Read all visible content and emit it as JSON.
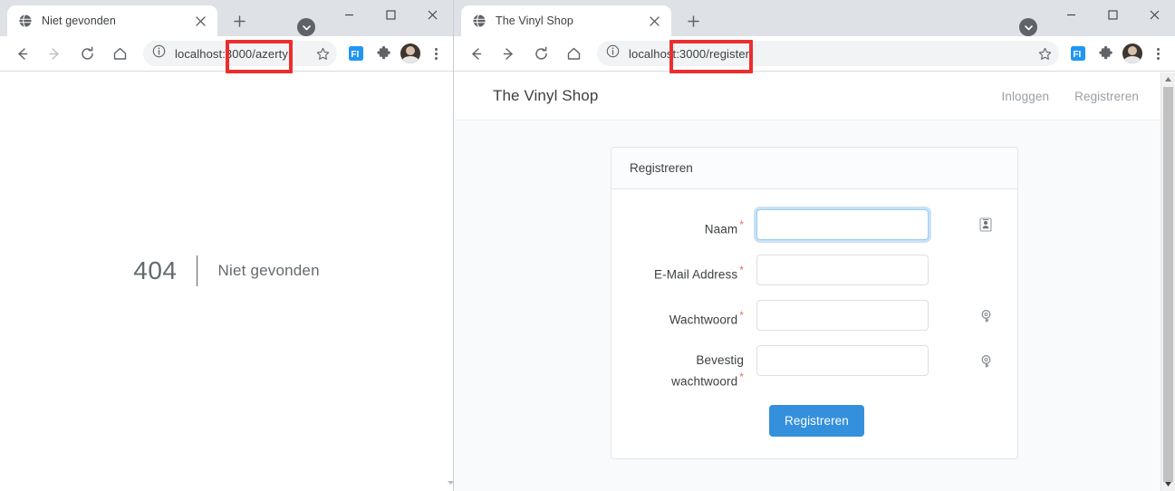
{
  "left_browser": {
    "tab": {
      "title": "Niet gevonden",
      "favicon": "globe-icon",
      "close": "×"
    },
    "new_tab_label": "+",
    "toolbar": {
      "back": "back-arrow",
      "forward": "forward-arrow",
      "reload": "reload-icon",
      "home": "home-icon",
      "url": "localhost:3000/azerty",
      "url_visible_prefix": "localhost:3",
      "url_highlighted": "000/azerty",
      "star": "bookmark-star-icon",
      "kebab": "more-menu-icon"
    },
    "window_controls": {
      "minimize": "—",
      "maximize": "▢",
      "close": "✕"
    },
    "page": {
      "error_code": "404",
      "error_message": "Niet gevonden"
    }
  },
  "right_browser": {
    "tab": {
      "title": "The Vinyl Shop",
      "favicon": "globe-icon",
      "close": "×"
    },
    "new_tab_label": "+",
    "toolbar": {
      "back": "back-arrow",
      "forward": "forward-arrow",
      "reload": "reload-icon",
      "home": "home-icon",
      "url": "localhost:3000/register",
      "star": "bookmark-star-icon",
      "kebab": "more-menu-icon"
    },
    "window_controls": {
      "minimize": "—",
      "maximize": "▢",
      "close": "✕"
    },
    "page": {
      "brand": "The Vinyl Shop",
      "nav_links": [
        {
          "label": "Inloggen"
        },
        {
          "label": "Registreren"
        }
      ],
      "card": {
        "title": "Registreren",
        "required_marker": "*",
        "fields": [
          {
            "label": "Naam",
            "value": "",
            "placeholder": "",
            "required": true,
            "focused": true,
            "icon": "contact-card-icon",
            "type": "text"
          },
          {
            "label": "E-Mail Address",
            "value": "",
            "placeholder": "",
            "required": true,
            "focused": false,
            "icon": "none",
            "type": "email"
          },
          {
            "label": "Wachtwoord",
            "value": "",
            "placeholder": "",
            "required": true,
            "focused": false,
            "icon": "key-icon",
            "type": "password"
          },
          {
            "label": "Bevestig wachtwoord",
            "value": "",
            "placeholder": "",
            "required": true,
            "focused": false,
            "icon": "key-icon",
            "type": "password"
          }
        ],
        "submit_label": "Registreren"
      }
    }
  },
  "annotations": {
    "highlight_color": "#ec2d2d",
    "boxes": [
      {
        "target": "left-url-segment",
        "text": "000/azerty"
      },
      {
        "target": "right-url-segment",
        "text": "000/register"
      }
    ]
  },
  "colors": {
    "tabstrip_bg": "#dee1e6",
    "toolbar_bg": "#ffffff",
    "omnibox_bg": "#f1f3f4",
    "page_bg": "#f8fafc",
    "primary_button": "#3490dc",
    "focus_ring": "#9ecbf0",
    "required_star": "#e8705a",
    "error_text": "#636b6f",
    "annotation_red": "#ec2d2d"
  }
}
